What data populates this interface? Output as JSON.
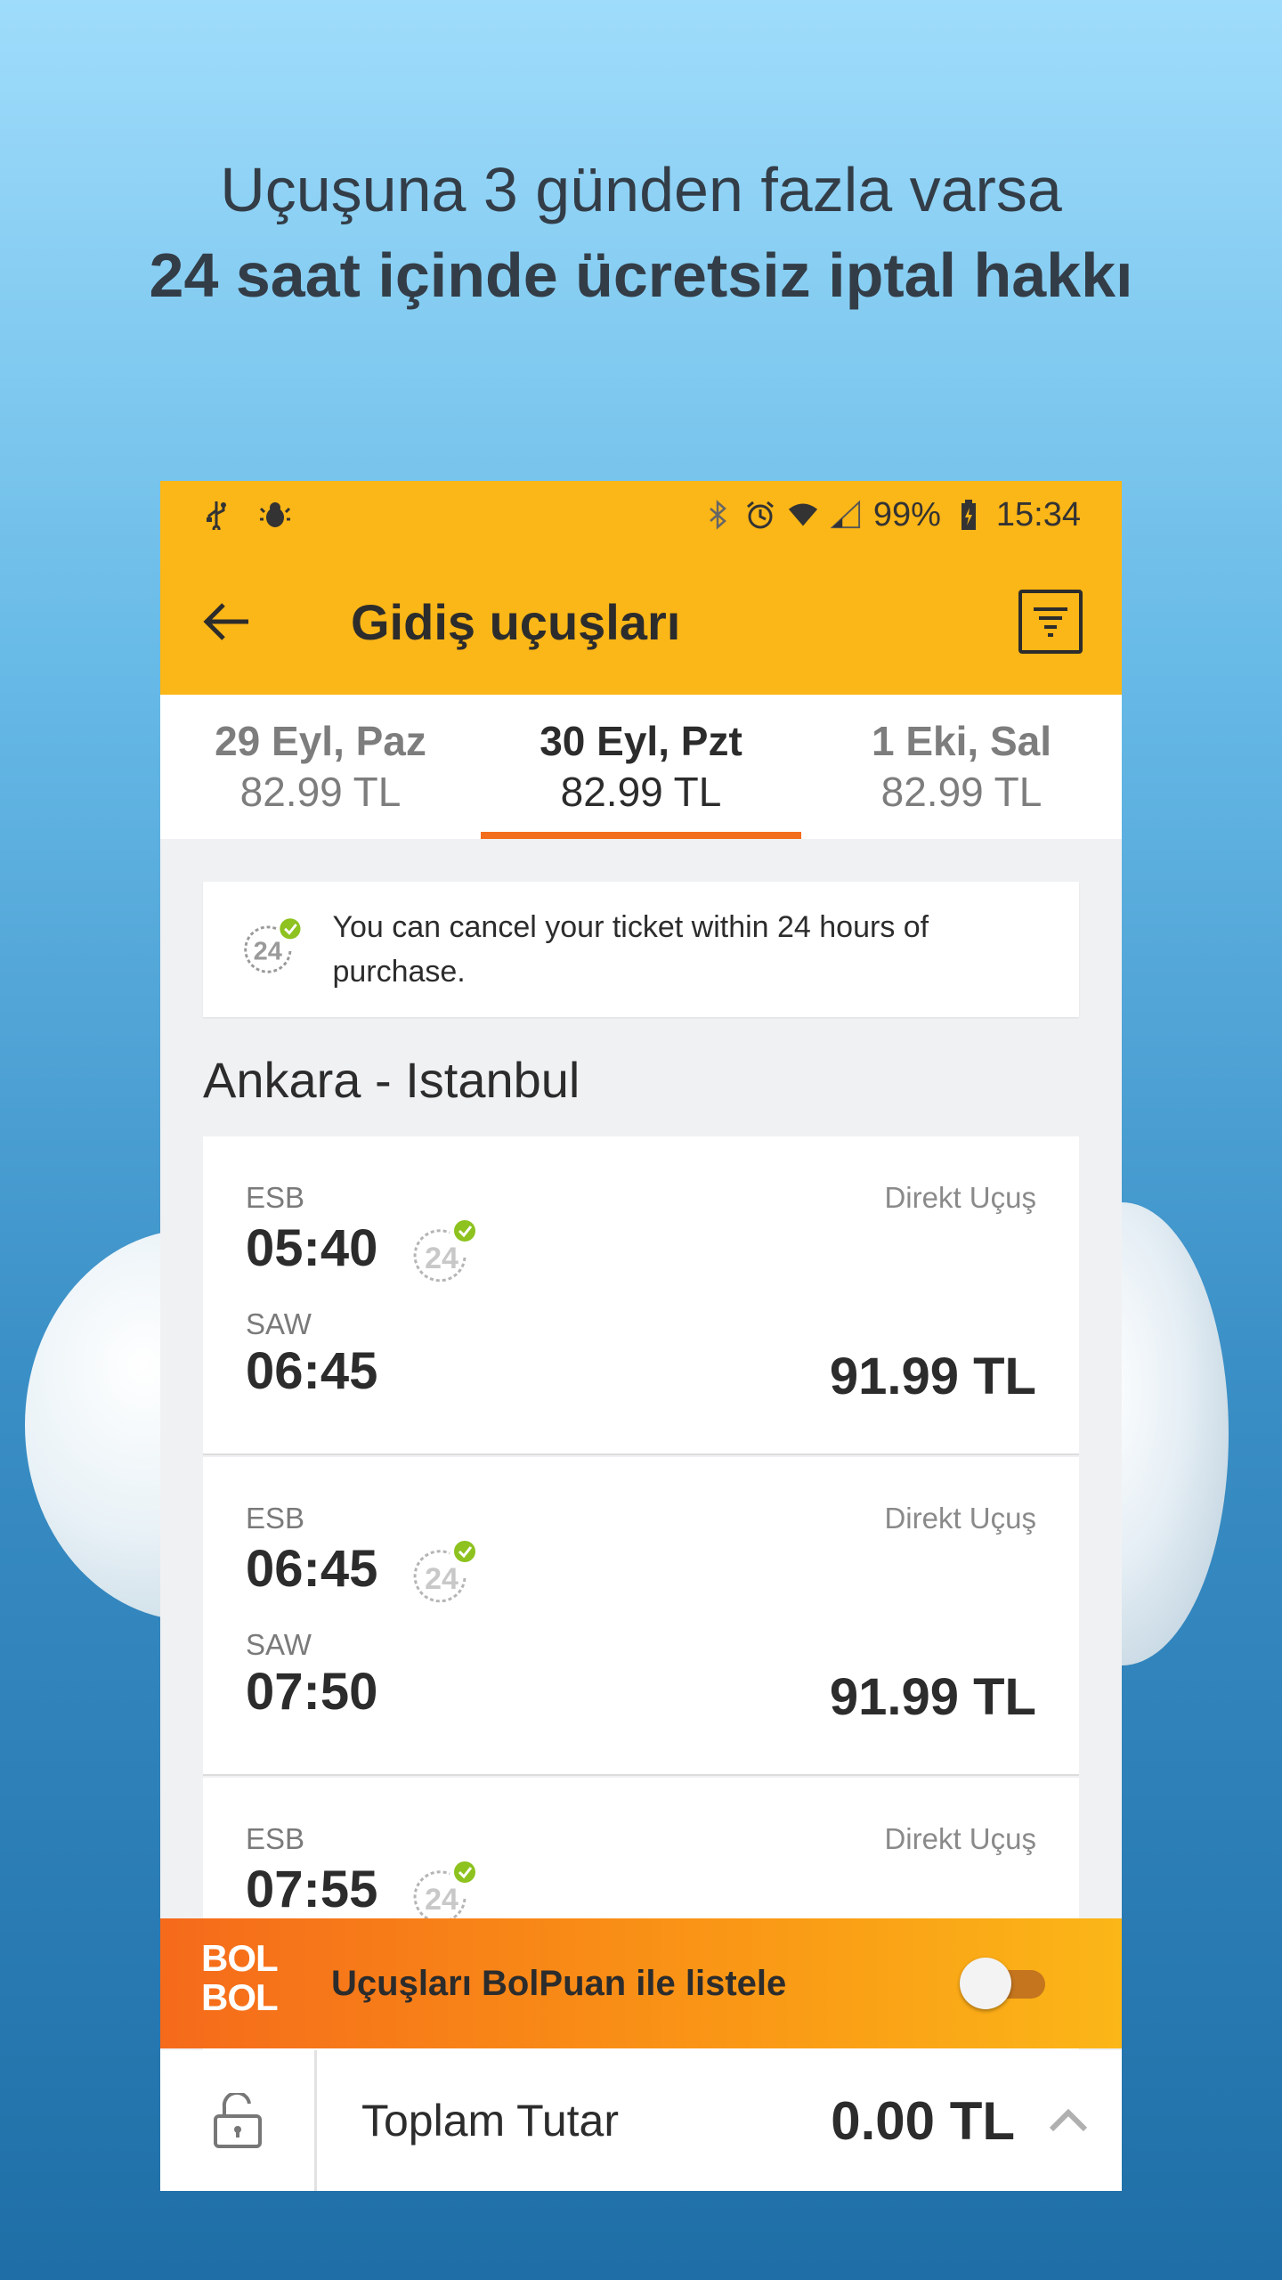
{
  "promo": {
    "line1": "Uçuşuna 3 günden fazla varsa",
    "line2": "24 saat içinde ücretsiz iptal hakkı"
  },
  "statusbar": {
    "battery": "99%",
    "time": "15:34",
    "icons": [
      "usb-icon",
      "bug-icon",
      "bluetooth-icon",
      "alarm-icon",
      "wifi-icon",
      "signal-icon",
      "battery-icon"
    ]
  },
  "appbar": {
    "title": "Gidiş uçuşları"
  },
  "date_tabs": [
    {
      "date": "29 Eyl, Paz",
      "price": "82.99 TL",
      "active": false
    },
    {
      "date": "30 Eyl, Pzt",
      "price": "82.99 TL",
      "active": true
    },
    {
      "date": "1 Eki, Sal",
      "price": "82.99 TL",
      "active": false
    }
  ],
  "info": {
    "badge": "24",
    "text": "You can cancel your ticket within 24 hours of purchase."
  },
  "route": "Ankara - Istanbul",
  "flights": [
    {
      "from_code": "ESB",
      "dep": "05:40",
      "to_code": "SAW",
      "arr": "06:45",
      "type": "Direkt Uçuş",
      "price": "91.99 TL",
      "badge": "24"
    },
    {
      "from_code": "ESB",
      "dep": "06:45",
      "to_code": "SAW",
      "arr": "07:50",
      "type": "Direkt Uçuş",
      "price": "91.99 TL",
      "badge": "24"
    },
    {
      "from_code": "ESB",
      "dep": "07:55",
      "to_code": "",
      "arr": "",
      "type": "Direkt Uçuş",
      "price": "",
      "badge": "24"
    }
  ],
  "bolpuan": {
    "logo_line1": "BOL",
    "logo_line2": "BOL",
    "label": "Uçuşları BolPuan ile listele",
    "toggle_on": false
  },
  "total": {
    "label": "Toplam Tutar",
    "amount": "0.00 TL"
  },
  "colors": {
    "accent": "#fbb617",
    "tab_indicator": "#f26d1c",
    "check_green": "#8dc21f"
  }
}
